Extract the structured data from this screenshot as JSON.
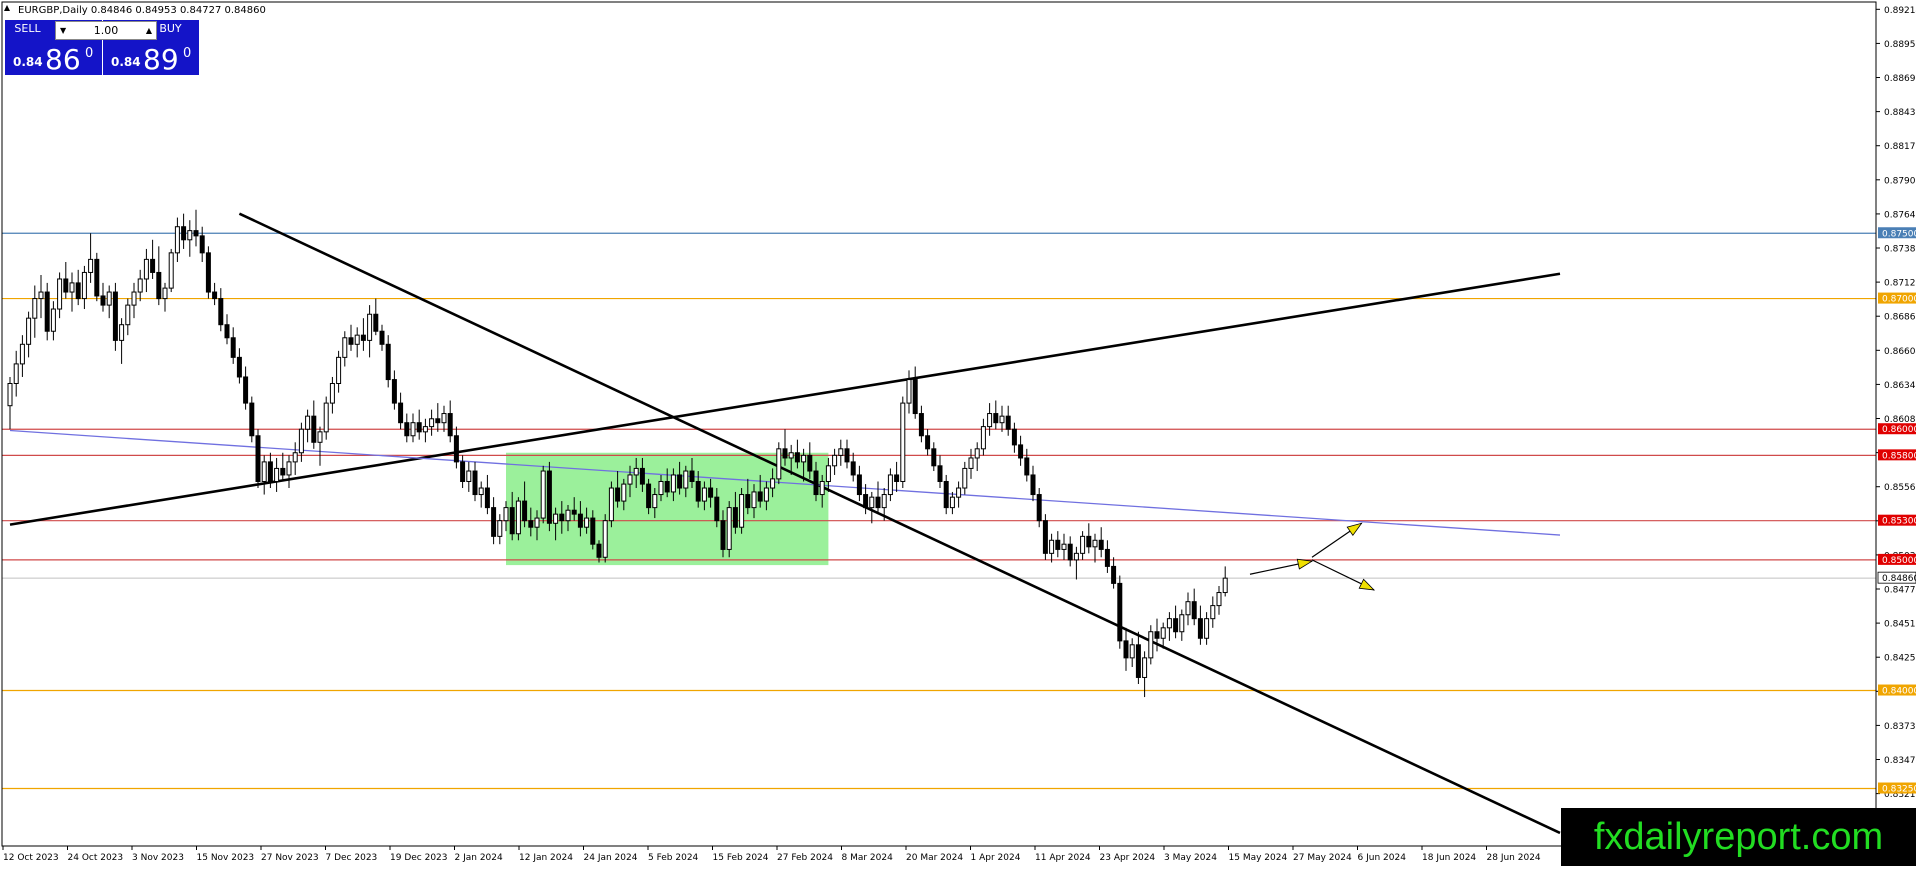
{
  "header": {
    "title": "EURGBP,Daily  0.84846 0.84953 0.84727 0.84860"
  },
  "trade_panel": {
    "sell_label": "SELL",
    "buy_label": "BUY",
    "lot": "1.00",
    "sell_prefix": "0.84",
    "sell_big": "86",
    "sell_sup": "0",
    "buy_prefix": "0.84",
    "buy_big": "89",
    "buy_sup": "0"
  },
  "logo": {
    "text": "fxdailyreport.com"
  },
  "chart_data": {
    "type": "candlestick",
    "symbol": "EURGBP",
    "timeframe": "Daily",
    "ylim": [
      0.8281,
      0.8927
    ],
    "y_ticks": [
      "0.89214",
      "0.88953",
      "0.88692",
      "0.88431",
      "0.88170",
      "0.87909",
      "0.87648",
      "0.87387",
      "0.87126",
      "0.86865",
      "0.86604",
      "0.86343",
      "0.86082",
      "0.85821",
      "0.85560",
      "0.85299",
      "0.85038",
      "0.84777",
      "0.84516",
      "0.84255",
      "0.83994",
      "0.83733",
      "0.83472",
      "0.83211",
      "0.82950"
    ],
    "x_tick_labels": [
      "12 Oct 2023",
      "24 Oct 2023",
      "3 Nov 2023",
      "15 Nov 2023",
      "27 Nov 2023",
      "7 Dec 2023",
      "19 Dec 2023",
      "2 Jan 2024",
      "12 Jan 2024",
      "24 Jan 2024",
      "5 Feb 2024",
      "15 Feb 2024",
      "27 Feb 2024",
      "8 Mar 2024",
      "20 Mar 2024",
      "1 Apr 2024",
      "11 Apr 2024",
      "23 Apr 2024",
      "3 May 2024",
      "15 May 2024",
      "27 May 2024",
      "6 Jun 2024",
      "18 Jun 2024",
      "28 Jun 2024"
    ],
    "current_price": "0.84860",
    "horizontal_levels": [
      {
        "price": 0.875,
        "label": "0.87500",
        "color": "#4a7fb5",
        "label_bg": "#4a7fb5"
      },
      {
        "price": 0.87,
        "label": "0.87000",
        "color": "#f0a500",
        "label_bg": "#f0a500"
      },
      {
        "price": 0.86,
        "label": "0.86000",
        "color": "#d04a4a",
        "label_bg": "#e00000"
      },
      {
        "price": 0.858,
        "label": "0.85800",
        "color": "#d04a4a",
        "label_bg": "#e00000"
      },
      {
        "price": 0.853,
        "label": "0.85300",
        "color": "#d04a4a",
        "label_bg": "#e00000"
      },
      {
        "price": 0.85,
        "label": "0.85000",
        "color": "#d04a4a",
        "label_bg": "#e00000"
      },
      {
        "price": 0.84,
        "label": "0.84000",
        "color": "#f0a500",
        "label_bg": "#f0a500"
      },
      {
        "price": 0.8325,
        "label": "0.83250",
        "color": "#f0a500",
        "label_bg": "#f0a500"
      }
    ],
    "trend_lines": [
      {
        "name": "downtrend",
        "color": "#000000",
        "points": [
          [
            37,
            0.8765
          ],
          [
            250,
            0.8291
          ]
        ]
      },
      {
        "name": "uptrend",
        "color": "#000000",
        "points": [
          [
            0,
            0.8527
          ],
          [
            250,
            0.8719
          ]
        ]
      },
      {
        "name": "blue-slope",
        "color": "#7070e0",
        "points": [
          [
            0,
            0.8599
          ],
          [
            250,
            0.8519
          ]
        ]
      }
    ],
    "rectangle": {
      "x_start": 80,
      "x_end": 132,
      "y_low": 0.8496,
      "y_high": 0.8582,
      "color": "#90ee90"
    },
    "arrows": [
      {
        "from": [
          200,
          0.8489
        ],
        "to": [
          210,
          0.8499
        ],
        "color": "#f0e000"
      },
      {
        "from": [
          210,
          0.8502
        ],
        "to": [
          218,
          0.8528
        ],
        "color": "#f0e000"
      },
      {
        "from": [
          210,
          0.85
        ],
        "to": [
          220,
          0.8477
        ],
        "color": "#f0e000"
      }
    ],
    "candles": [
      [
        0.8618,
        0.864,
        0.86,
        0.8635
      ],
      [
        0.8635,
        0.866,
        0.8625,
        0.865
      ],
      [
        0.865,
        0.8672,
        0.864,
        0.8665
      ],
      [
        0.8665,
        0.869,
        0.8655,
        0.8685
      ],
      [
        0.8685,
        0.871,
        0.867,
        0.87
      ],
      [
        0.87,
        0.8718,
        0.8685,
        0.8705
      ],
      [
        0.8705,
        0.8712,
        0.8668,
        0.8675
      ],
      [
        0.8675,
        0.8698,
        0.8668,
        0.8692
      ],
      [
        0.8692,
        0.872,
        0.8685,
        0.8715
      ],
      [
        0.8715,
        0.8728,
        0.87,
        0.8705
      ],
      [
        0.8705,
        0.872,
        0.869,
        0.8712
      ],
      [
        0.8712,
        0.8722,
        0.8695,
        0.87
      ],
      [
        0.87,
        0.8725,
        0.8692,
        0.872
      ],
      [
        0.872,
        0.875,
        0.8712,
        0.873
      ],
      [
        0.873,
        0.8735,
        0.8698,
        0.8702
      ],
      [
        0.8702,
        0.8712,
        0.869,
        0.8695
      ],
      [
        0.8695,
        0.871,
        0.8685,
        0.8705
      ],
      [
        0.8705,
        0.8712,
        0.866,
        0.8668
      ],
      [
        0.8668,
        0.8685,
        0.865,
        0.868
      ],
      [
        0.868,
        0.87,
        0.8672,
        0.8695
      ],
      [
        0.8695,
        0.8712,
        0.8685,
        0.8705
      ],
      [
        0.8705,
        0.8722,
        0.8698,
        0.8715
      ],
      [
        0.8715,
        0.8738,
        0.8705,
        0.873
      ],
      [
        0.873,
        0.8745,
        0.8715,
        0.872
      ],
      [
        0.872,
        0.874,
        0.8695,
        0.87
      ],
      [
        0.87,
        0.8712,
        0.869,
        0.8708
      ],
      [
        0.8708,
        0.8738,
        0.8705,
        0.8735
      ],
      [
        0.8735,
        0.8762,
        0.8728,
        0.8755
      ],
      [
        0.8755,
        0.8765,
        0.8738,
        0.8745
      ],
      [
        0.8745,
        0.876,
        0.8732,
        0.8752
      ],
      [
        0.8752,
        0.8768,
        0.874,
        0.8748
      ],
      [
        0.8748,
        0.8755,
        0.8728,
        0.8735
      ],
      [
        0.8735,
        0.874,
        0.87,
        0.8705
      ],
      [
        0.8705,
        0.8712,
        0.8695,
        0.87
      ],
      [
        0.87,
        0.8708,
        0.8675,
        0.868
      ],
      [
        0.868,
        0.8688,
        0.8665,
        0.867
      ],
      [
        0.867,
        0.8678,
        0.865,
        0.8655
      ],
      [
        0.8655,
        0.8662,
        0.8635,
        0.864
      ],
      [
        0.864,
        0.8648,
        0.8615,
        0.862
      ],
      [
        0.862,
        0.8625,
        0.859,
        0.8595
      ],
      [
        0.8595,
        0.86,
        0.8555,
        0.856
      ],
      [
        0.856,
        0.858,
        0.855,
        0.8575
      ],
      [
        0.8575,
        0.8582,
        0.8555,
        0.856
      ],
      [
        0.856,
        0.8578,
        0.8552,
        0.857
      ],
      [
        0.857,
        0.8582,
        0.856,
        0.8565
      ],
      [
        0.8565,
        0.858,
        0.8555,
        0.8575
      ],
      [
        0.8575,
        0.859,
        0.8565,
        0.8582
      ],
      [
        0.8582,
        0.8605,
        0.8575,
        0.86
      ],
      [
        0.86,
        0.8615,
        0.859,
        0.861
      ],
      [
        0.861,
        0.8622,
        0.8585,
        0.859
      ],
      [
        0.859,
        0.8602,
        0.8572,
        0.8598
      ],
      [
        0.8598,
        0.8625,
        0.8592,
        0.862
      ],
      [
        0.862,
        0.864,
        0.8612,
        0.8635
      ],
      [
        0.8635,
        0.866,
        0.8628,
        0.8655
      ],
      [
        0.8655,
        0.8675,
        0.8648,
        0.867
      ],
      [
        0.867,
        0.868,
        0.866,
        0.8665
      ],
      [
        0.8665,
        0.8678,
        0.8655,
        0.8672
      ],
      [
        0.8672,
        0.8685,
        0.866,
        0.8668
      ],
      [
        0.8668,
        0.8695,
        0.8655,
        0.8688
      ],
      [
        0.8688,
        0.87,
        0.8672,
        0.8675
      ],
      [
        0.8675,
        0.868,
        0.866,
        0.8665
      ],
      [
        0.8665,
        0.8672,
        0.8632,
        0.8638
      ],
      [
        0.8638,
        0.8645,
        0.8615,
        0.862
      ],
      [
        0.862,
        0.8628,
        0.86,
        0.8605
      ],
      [
        0.8605,
        0.8612,
        0.859,
        0.8595
      ],
      [
        0.8595,
        0.8612,
        0.859,
        0.8605
      ],
      [
        0.8605,
        0.8615,
        0.8592,
        0.8598
      ],
      [
        0.8598,
        0.8608,
        0.859,
        0.8602
      ],
      [
        0.8602,
        0.8615,
        0.8595,
        0.8608
      ],
      [
        0.8608,
        0.862,
        0.8598,
        0.8605
      ],
      [
        0.8605,
        0.8618,
        0.8598,
        0.8612
      ],
      [
        0.8612,
        0.8622,
        0.859,
        0.8595
      ],
      [
        0.8595,
        0.8602,
        0.857,
        0.8575
      ],
      [
        0.8575,
        0.858,
        0.8555,
        0.856
      ],
      [
        0.856,
        0.8575,
        0.8552,
        0.8568
      ],
      [
        0.8568,
        0.8575,
        0.8545,
        0.855
      ],
      [
        0.855,
        0.856,
        0.854,
        0.8555
      ],
      [
        0.8555,
        0.8565,
        0.8535,
        0.854
      ],
      [
        0.854,
        0.8548,
        0.8512,
        0.8518
      ],
      [
        0.8518,
        0.8535,
        0.8512,
        0.853
      ],
      [
        0.853,
        0.8545,
        0.8522,
        0.854
      ],
      [
        0.854,
        0.8552,
        0.8515,
        0.852
      ],
      [
        0.852,
        0.8548,
        0.8515,
        0.8545
      ],
      [
        0.8545,
        0.856,
        0.8525,
        0.853
      ],
      [
        0.853,
        0.854,
        0.8518,
        0.8525
      ],
      [
        0.8525,
        0.8538,
        0.8515,
        0.8532
      ],
      [
        0.8532,
        0.8572,
        0.8528,
        0.8568
      ],
      [
        0.8568,
        0.8575,
        0.8522,
        0.8528
      ],
      [
        0.8528,
        0.854,
        0.8515,
        0.8535
      ],
      [
        0.8535,
        0.8545,
        0.852,
        0.853
      ],
      [
        0.853,
        0.8542,
        0.8522,
        0.8538
      ],
      [
        0.8538,
        0.8548,
        0.853,
        0.8535
      ],
      [
        0.8535,
        0.8545,
        0.8518,
        0.8525
      ],
      [
        0.8525,
        0.854,
        0.852,
        0.8532
      ],
      [
        0.8532,
        0.8538,
        0.8508,
        0.8512
      ],
      [
        0.8512,
        0.8515,
        0.8498,
        0.8502
      ],
      [
        0.8502,
        0.8535,
        0.8498,
        0.853
      ],
      [
        0.853,
        0.856,
        0.8525,
        0.8555
      ],
      [
        0.8555,
        0.8568,
        0.854,
        0.8545
      ],
      [
        0.8545,
        0.8562,
        0.8538,
        0.8558
      ],
      [
        0.8558,
        0.8572,
        0.8548,
        0.8565
      ],
      [
        0.8565,
        0.8578,
        0.8555,
        0.857
      ],
      [
        0.857,
        0.8578,
        0.8552,
        0.8558
      ],
      [
        0.8558,
        0.8562,
        0.8535,
        0.854
      ],
      [
        0.854,
        0.8555,
        0.8532,
        0.855
      ],
      [
        0.855,
        0.8565,
        0.8545,
        0.856
      ],
      [
        0.856,
        0.857,
        0.8548,
        0.8552
      ],
      [
        0.8552,
        0.857,
        0.8545,
        0.8565
      ],
      [
        0.8565,
        0.8575,
        0.855,
        0.8555
      ],
      [
        0.8555,
        0.8572,
        0.8548,
        0.8568
      ],
      [
        0.8568,
        0.8578,
        0.8555,
        0.856
      ],
      [
        0.856,
        0.8568,
        0.854,
        0.8545
      ],
      [
        0.8545,
        0.856,
        0.8538,
        0.8555
      ],
      [
        0.8555,
        0.8562,
        0.854,
        0.8548
      ],
      [
        0.8548,
        0.8555,
        0.8525,
        0.853
      ],
      [
        0.853,
        0.8538,
        0.8502,
        0.8508
      ],
      [
        0.8508,
        0.8545,
        0.8502,
        0.854
      ],
      [
        0.854,
        0.8552,
        0.852,
        0.8525
      ],
      [
        0.8525,
        0.8555,
        0.852,
        0.855
      ],
      [
        0.855,
        0.8562,
        0.8535,
        0.854
      ],
      [
        0.854,
        0.8558,
        0.8532,
        0.8552
      ],
      [
        0.8552,
        0.8565,
        0.854,
        0.8545
      ],
      [
        0.8545,
        0.856,
        0.8538,
        0.8555
      ],
      [
        0.8555,
        0.857,
        0.8548,
        0.8562
      ],
      [
        0.8562,
        0.859,
        0.8558,
        0.8585
      ],
      [
        0.8585,
        0.86,
        0.8572,
        0.8578
      ],
      [
        0.8578,
        0.8588,
        0.8565,
        0.8582
      ],
      [
        0.8582,
        0.8592,
        0.857,
        0.8575
      ],
      [
        0.8575,
        0.8585,
        0.856,
        0.858
      ],
      [
        0.858,
        0.859,
        0.8562,
        0.8568
      ],
      [
        0.8568,
        0.8575,
        0.8545,
        0.855
      ],
      [
        0.855,
        0.8565,
        0.854,
        0.856
      ],
      [
        0.856,
        0.8578,
        0.8552,
        0.8572
      ],
      [
        0.8572,
        0.8585,
        0.8565,
        0.858
      ],
      [
        0.858,
        0.8592,
        0.8572,
        0.8585
      ],
      [
        0.8585,
        0.8592,
        0.857,
        0.8575
      ],
      [
        0.8575,
        0.8582,
        0.856,
        0.8565
      ],
      [
        0.8565,
        0.8572,
        0.8545,
        0.855
      ],
      [
        0.855,
        0.8558,
        0.8535,
        0.854
      ],
      [
        0.854,
        0.8552,
        0.8528,
        0.8548
      ],
      [
        0.8548,
        0.856,
        0.8535,
        0.854
      ],
      [
        0.854,
        0.8555,
        0.853,
        0.855
      ],
      [
        0.855,
        0.857,
        0.8545,
        0.8565
      ],
      [
        0.8565,
        0.8575,
        0.8552,
        0.856
      ],
      [
        0.856,
        0.8625,
        0.8555,
        0.862
      ],
      [
        0.862,
        0.8645,
        0.8612,
        0.8638
      ],
      [
        0.8638,
        0.8648,
        0.8608,
        0.8612
      ],
      [
        0.8612,
        0.8618,
        0.859,
        0.8595
      ],
      [
        0.8595,
        0.86,
        0.858,
        0.8585
      ],
      [
        0.8585,
        0.859,
        0.8568,
        0.8572
      ],
      [
        0.8572,
        0.858,
        0.8555,
        0.856
      ],
      [
        0.856,
        0.8565,
        0.8535,
        0.854
      ],
      [
        0.854,
        0.8552,
        0.8535,
        0.8548
      ],
      [
        0.8548,
        0.856,
        0.854,
        0.8555
      ],
      [
        0.8555,
        0.8575,
        0.855,
        0.857
      ],
      [
        0.857,
        0.8585,
        0.8562,
        0.8578
      ],
      [
        0.8578,
        0.859,
        0.8568,
        0.8585
      ],
      [
        0.8585,
        0.8608,
        0.858,
        0.8602
      ],
      [
        0.8602,
        0.862,
        0.8595,
        0.8612
      ],
      [
        0.8612,
        0.8622,
        0.86,
        0.8605
      ],
      [
        0.8605,
        0.8618,
        0.8598,
        0.861
      ],
      [
        0.861,
        0.8618,
        0.8595,
        0.86
      ],
      [
        0.86,
        0.8605,
        0.8582,
        0.8588
      ],
      [
        0.8588,
        0.8595,
        0.8572,
        0.8578
      ],
      [
        0.8578,
        0.8585,
        0.856,
        0.8565
      ],
      [
        0.8565,
        0.8572,
        0.8545,
        0.855
      ],
      [
        0.855,
        0.8555,
        0.8525,
        0.853
      ],
      [
        0.853,
        0.8535,
        0.85,
        0.8505
      ],
      [
        0.8505,
        0.852,
        0.8498,
        0.8515
      ],
      [
        0.8515,
        0.8522,
        0.8502,
        0.8508
      ],
      [
        0.8508,
        0.852,
        0.85,
        0.8512
      ],
      [
        0.8512,
        0.8518,
        0.8495,
        0.85
      ],
      [
        0.85,
        0.851,
        0.8485,
        0.8505
      ],
      [
        0.8505,
        0.8522,
        0.85,
        0.8518
      ],
      [
        0.8518,
        0.8528,
        0.8505,
        0.851
      ],
      [
        0.851,
        0.852,
        0.8498,
        0.8515
      ],
      [
        0.8515,
        0.8525,
        0.8502,
        0.8508
      ],
      [
        0.8508,
        0.8515,
        0.849,
        0.8495
      ],
      [
        0.8495,
        0.8502,
        0.8478,
        0.8482
      ],
      [
        0.8482,
        0.8488,
        0.8432,
        0.8438
      ],
      [
        0.8438,
        0.8448,
        0.8415,
        0.8425
      ],
      [
        0.8425,
        0.844,
        0.8418,
        0.8435
      ],
      [
        0.8435,
        0.8445,
        0.8405,
        0.841
      ],
      [
        0.841,
        0.843,
        0.8395,
        0.8425
      ],
      [
        0.8425,
        0.845,
        0.842,
        0.8445
      ],
      [
        0.8445,
        0.8455,
        0.843,
        0.844
      ],
      [
        0.844,
        0.8452,
        0.8432,
        0.8448
      ],
      [
        0.8448,
        0.846,
        0.8438,
        0.8455
      ],
      [
        0.8455,
        0.8465,
        0.844,
        0.8445
      ],
      [
        0.8445,
        0.8462,
        0.8438,
        0.8458
      ],
      [
        0.8458,
        0.8475,
        0.845,
        0.8468
      ],
      [
        0.8468,
        0.8478,
        0.845,
        0.8455
      ],
      [
        0.8455,
        0.8465,
        0.8435,
        0.844
      ],
      [
        0.844,
        0.846,
        0.8435,
        0.8455
      ],
      [
        0.8455,
        0.8472,
        0.8448,
        0.8465
      ],
      [
        0.8465,
        0.848,
        0.8458,
        0.8475
      ],
      [
        0.8475,
        0.8495,
        0.8472,
        0.8486
      ]
    ]
  }
}
